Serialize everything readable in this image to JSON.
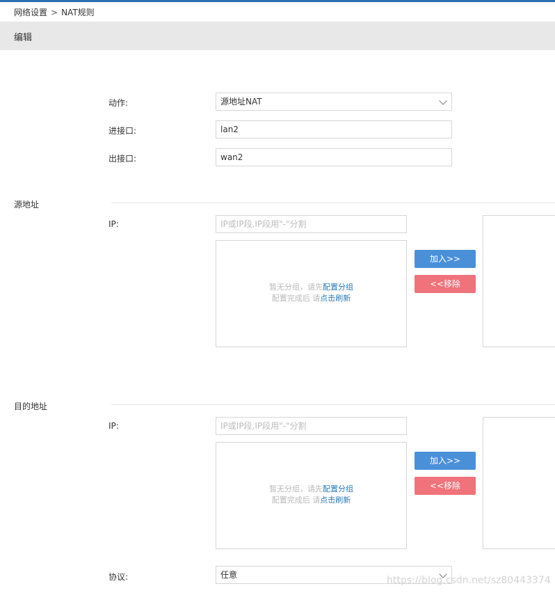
{
  "breadcrumb": {
    "parent": "网络设置",
    "separator": ">",
    "current": "NAT规则"
  },
  "panel": {
    "title": "编辑"
  },
  "form": {
    "action": {
      "label": "动作:",
      "value": "源地址NAT"
    },
    "in_interface": {
      "label": "进接口:",
      "value": "lan2"
    },
    "out_interface": {
      "label": "出接口:",
      "value": "wan2"
    }
  },
  "source": {
    "title": "源地址",
    "ip_label": "IP:",
    "ip_placeholder": "IP或IP段,IP段用\"-\"分割",
    "empty_line1_prefix": "暂无分组，请先",
    "empty_link1": "配置分组",
    "empty_line2_prefix": "配置完成后 请",
    "empty_link2": "点击刷新",
    "add_label": "加入>>",
    "remove_label": "<<移除"
  },
  "destination": {
    "title": "目的地址",
    "ip_label": "IP:",
    "ip_placeholder": "IP或IP段,IP段用\"-\"分割",
    "empty_line1_prefix": "暂无分组，请先",
    "empty_link1": "配置分组",
    "empty_line2_prefix": "配置完成后 请",
    "empty_link2": "点击刷新",
    "add_label": "加入>>",
    "remove_label": "<<移除"
  },
  "protocol": {
    "label": "协议:",
    "value": "任意"
  },
  "watermark": "https://blog.csdn.net/sz80443374",
  "colors": {
    "top_accent": "#2a6fb0",
    "add_button": "#4a90d9",
    "remove_button": "#f0727a",
    "link": "#2a7ab8"
  }
}
